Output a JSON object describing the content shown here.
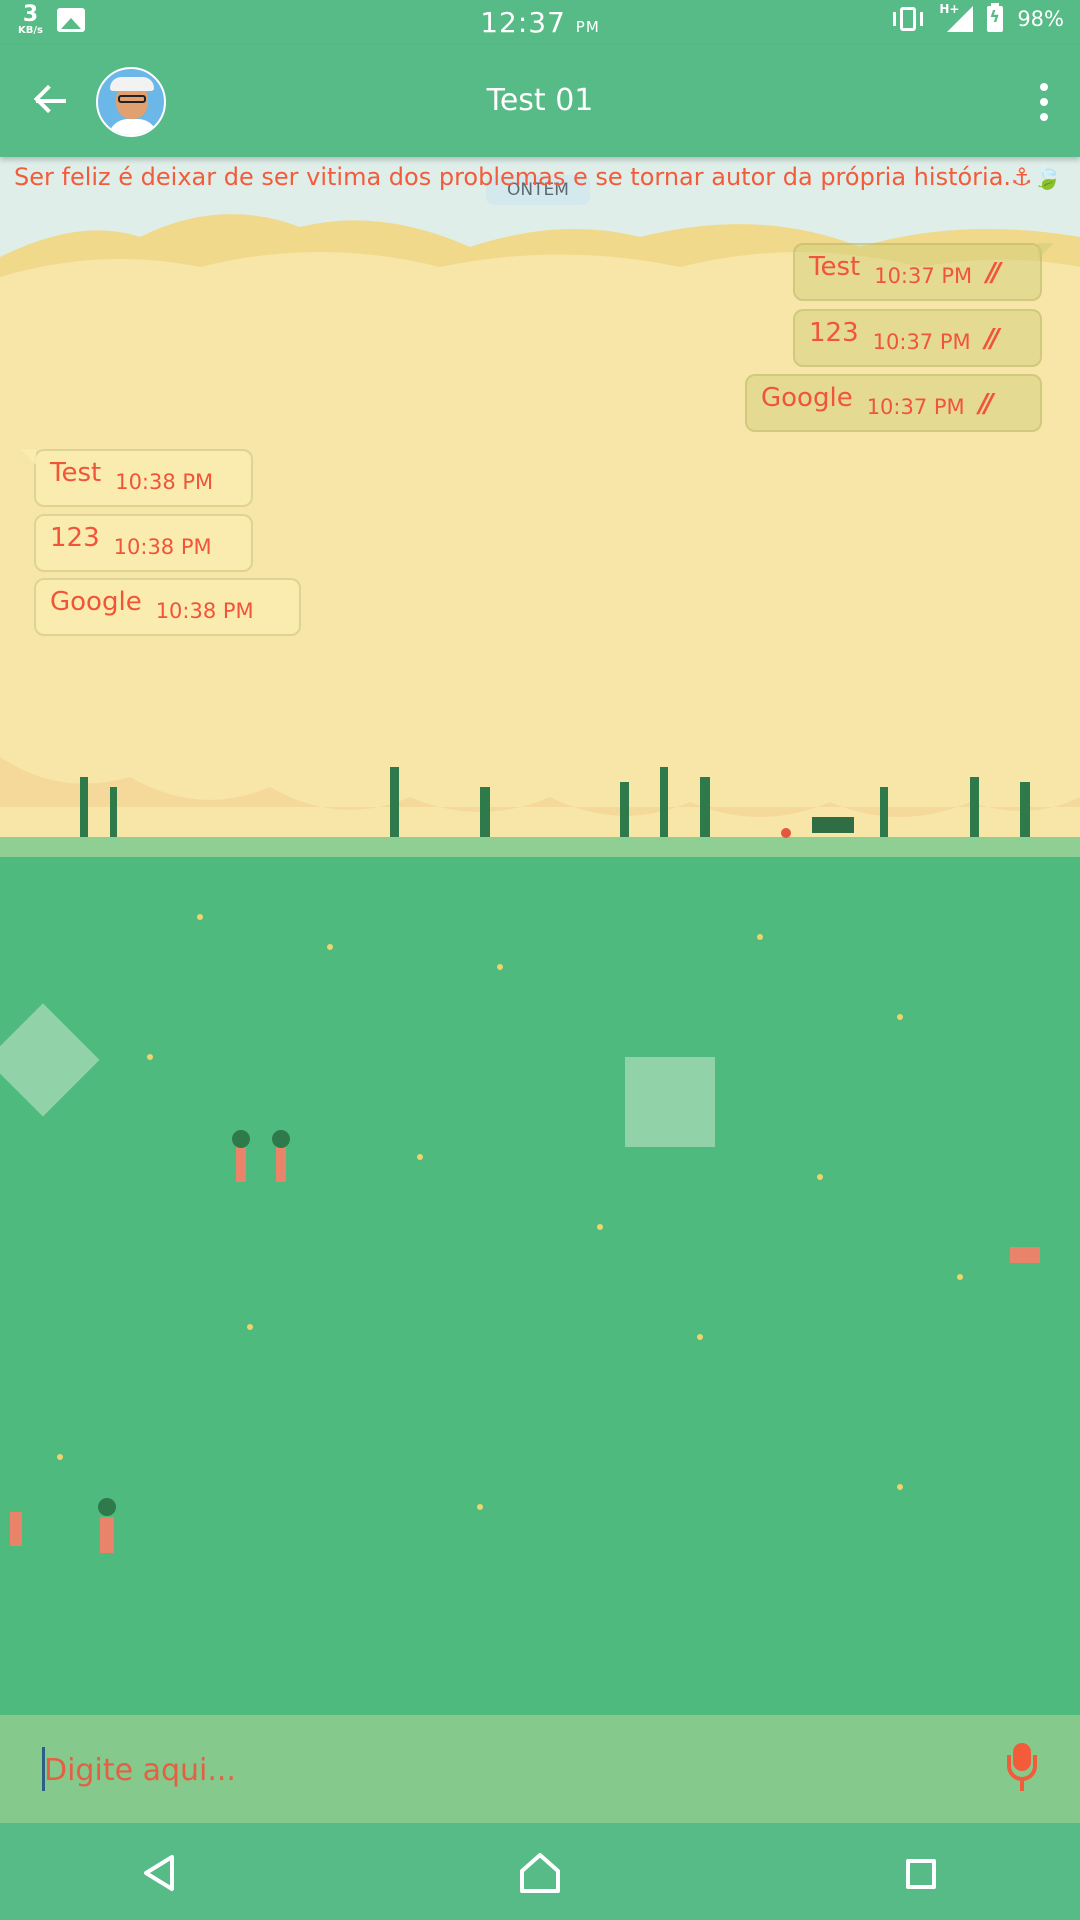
{
  "status_bar": {
    "net_speed": "3",
    "net_unit": "KB/s",
    "time": "12:37",
    "time_ampm": "PM",
    "network_type": "H+",
    "battery": "98%"
  },
  "header": {
    "title": "Test 01",
    "avatar": "contact-avatar",
    "back_icon": "back-arrow-icon",
    "menu_icon": "more-vert-icon"
  },
  "chat": {
    "status_text": "Ser feliz é deixar de ser vitima dos problemas e se tornar autor da própria história.⚓🍃",
    "date_label": "ONTEM",
    "sent": [
      {
        "text": "Test",
        "time": "10:37 PM",
        "ticks": "//"
      },
      {
        "text": "123",
        "time": "10:37 PM",
        "ticks": "//"
      },
      {
        "text": "Google",
        "time": "10:37 PM",
        "ticks": "//"
      }
    ],
    "received": [
      {
        "text": "Test",
        "time": "10:38 PM"
      },
      {
        "text": "123",
        "time": "10:38 PM"
      },
      {
        "text": "Google",
        "time": "10:38 PM"
      }
    ]
  },
  "composer": {
    "placeholder": "Digite aqui...",
    "mic_icon": "microphone-icon"
  },
  "nav": {
    "back": "nav-back-icon",
    "home": "nav-home-icon",
    "recents": "nav-recents-icon"
  },
  "colors": {
    "primary": "#56bb86",
    "accent": "#f25c3a",
    "composer": "#86c98d",
    "sky": "#dfeee9",
    "foliage": "#f8e6a8",
    "grass": "#4fba7d"
  }
}
